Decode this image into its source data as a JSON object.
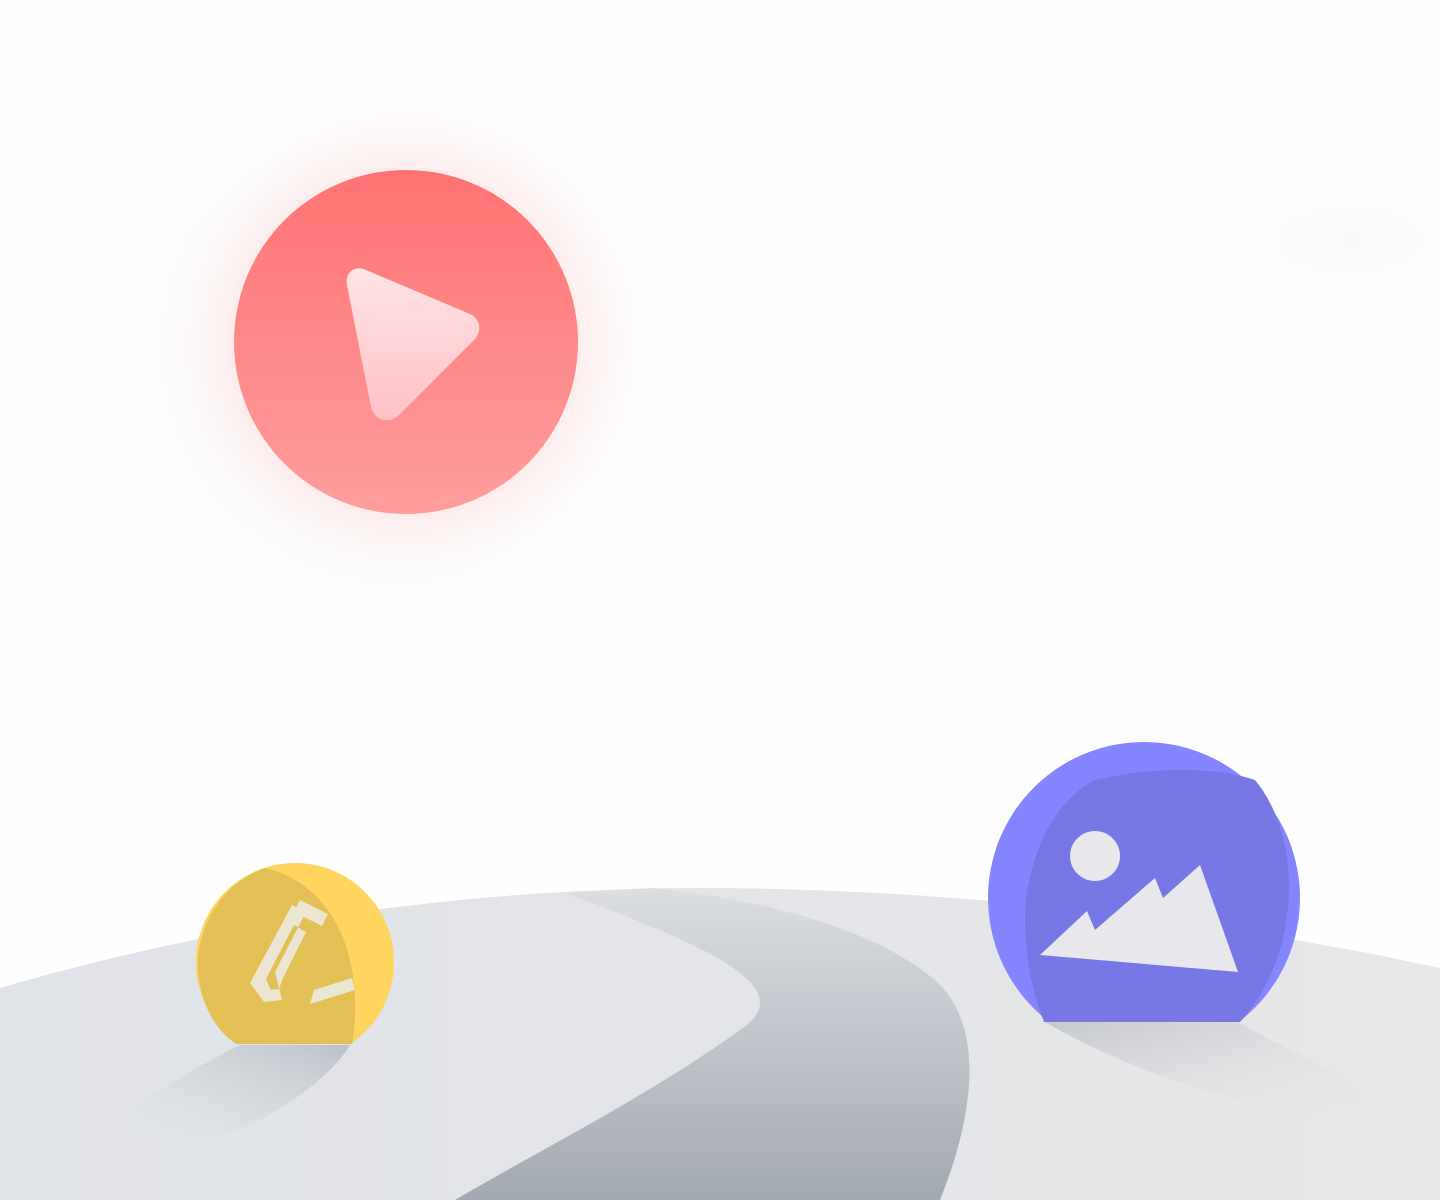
{
  "illustration": {
    "icons": [
      {
        "name": "play-icon",
        "role": "video"
      },
      {
        "name": "pencil-icon",
        "role": "edit"
      },
      {
        "name": "image-icon",
        "role": "photo"
      }
    ],
    "colors": {
      "background": "#fefefe",
      "play_top": "#ff7272",
      "play_bottom": "#ff9e9e",
      "play_glyph": "#ffd3d6",
      "pencil_badge": "#ffd45f",
      "pencil_badge_shade": "#e3c055",
      "pencil_glyph": "#ebe6d2",
      "image_badge": "#8586ff",
      "image_badge_shade": "#7777e6",
      "image_glyph": "#e7e7ec",
      "ground": "#e3e5e8",
      "path_light": "#d4d7dc",
      "path_dark": "#a7acb4"
    }
  }
}
